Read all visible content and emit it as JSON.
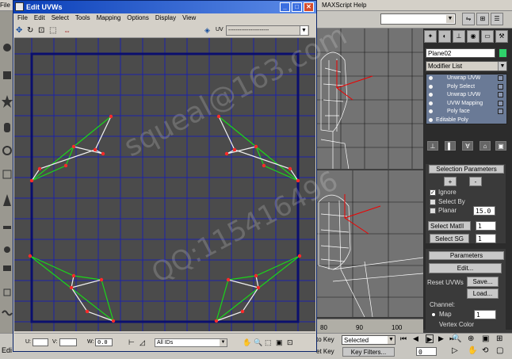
{
  "main_menu": {
    "left_fragment": "File",
    "maxscript": "MAXScript",
    "help": "Help"
  },
  "uvw_window": {
    "title": "Edit UVWs",
    "menu": [
      "File",
      "Edit",
      "Select",
      "Tools",
      "Mapping",
      "Options",
      "Display",
      "View"
    ],
    "uv_label": "UV",
    "map_dropdown_value": "----------------------",
    "bottom": {
      "u_label": "U:",
      "v_label": "V:",
      "w_label": "W:",
      "w_value": "0.0",
      "ids_dropdown": "All IDs"
    }
  },
  "watermark": {
    "line1": "squeal@163.com",
    "line2": "QQ:115416496"
  },
  "command_panel": {
    "object_name": "Plane02",
    "object_color": "#2fd26b",
    "modifier_list_label": "Modifier List",
    "stack": [
      "Unwrap UVW",
      "Poly Select",
      "Unwrap UVW",
      "UVW Mapping",
      "Poly face",
      "Editable Poly"
    ],
    "selection_parameters": {
      "title": "Selection Parameters",
      "plus": "+",
      "minus": "-",
      "ignore_label": "Ignore",
      "select_by_label": "Select By",
      "planar_label": "Planar",
      "planar_value": "15.0",
      "select_matid_label": "Select MatII",
      "select_matid_value": "1",
      "select_sg_label": "Select SG",
      "select_sg_value": "1"
    },
    "parameters": {
      "title": "Parameters",
      "edit_button": "Edit...",
      "reset_uvws": "Reset UVWs",
      "save_button": "Save...",
      "load_button": "Load...",
      "channel_label": "Channel:",
      "map_label": "Map",
      "map_value": "1",
      "vertex_color_label": "Vertex Color"
    }
  },
  "timeline": {
    "ticks": [
      "80",
      "90",
      "100"
    ]
  },
  "status_bar": {
    "edit_fragment": "Edi",
    "auto_key_fragment": "to Key",
    "set_key_fragment": "et Key",
    "selected_dropdown": "Selected",
    "key_filters": "Key Filters...",
    "frame_value": "0"
  }
}
